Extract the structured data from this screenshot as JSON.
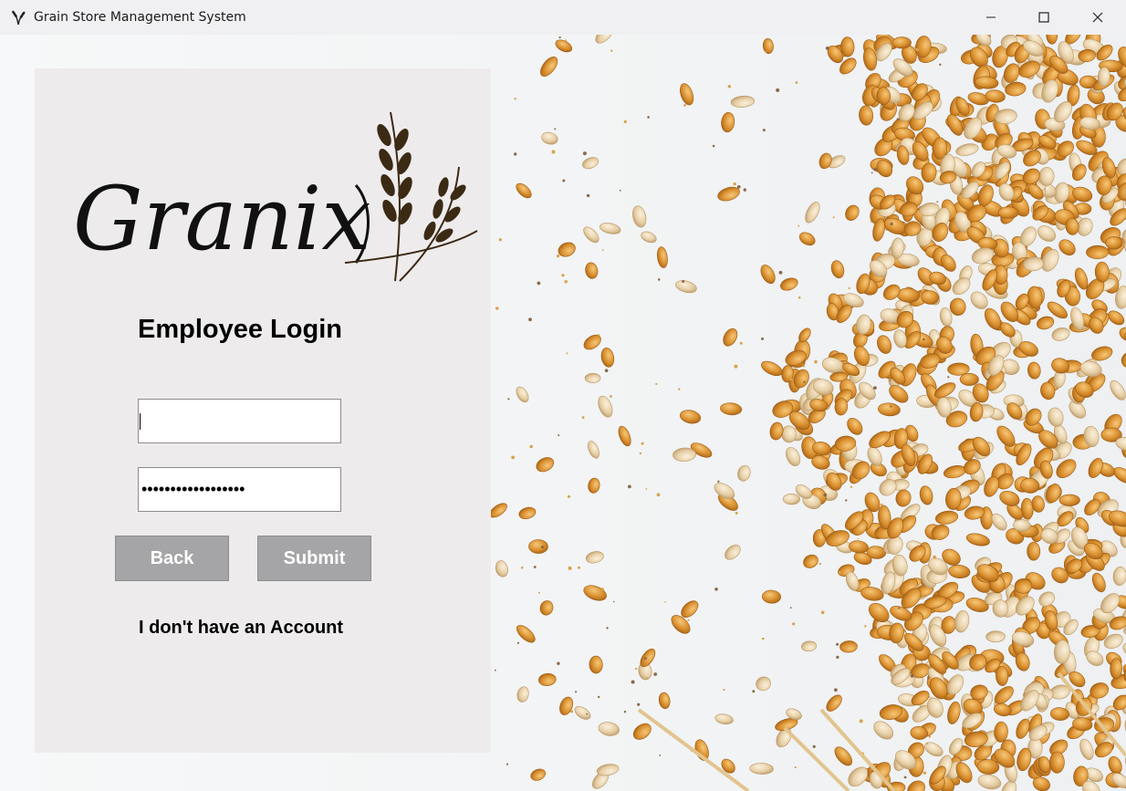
{
  "window": {
    "title": "Grain Store Management System",
    "icon": "wheat-icon",
    "controls": [
      "minimize-icon",
      "maximize-icon",
      "close-icon"
    ]
  },
  "background": {
    "image": "wheat-grains-photo"
  },
  "login": {
    "logo_text": "Granix",
    "heading": "Employee Login",
    "username": {
      "value": "",
      "placeholder": ""
    },
    "password": {
      "value": "••••••••••••••••••",
      "masked": true
    },
    "back_label": "Back",
    "submit_label": "Submit",
    "no_account_label": "I don't have an Account"
  },
  "colors": {
    "panel_bg": "#eeebec",
    "button_bg": "#a5a4a6",
    "button_text": "#ffffff",
    "titlebar_bg": "#f0f0f2"
  }
}
